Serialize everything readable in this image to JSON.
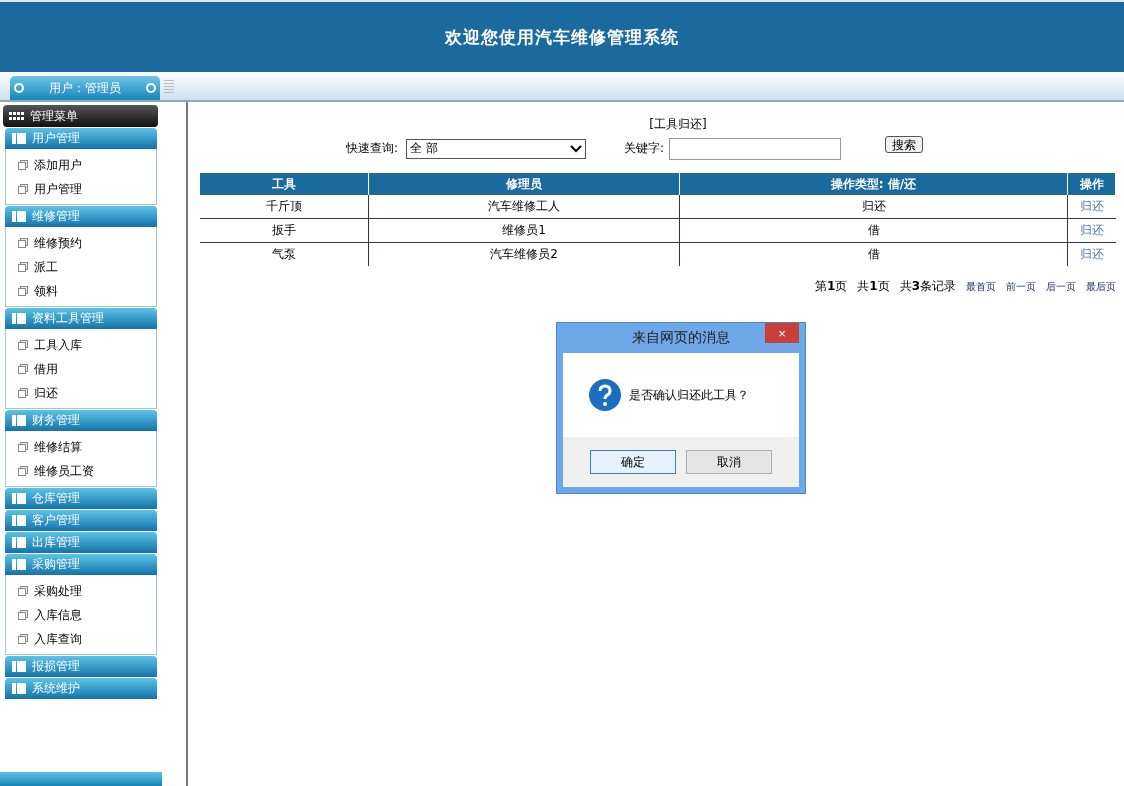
{
  "header": {
    "title": "欢迎您使用汽车维修管理系统"
  },
  "user_tab": {
    "label": "用户：管理员"
  },
  "sidebar": {
    "title": "管理菜单",
    "groups": [
      {
        "label": "用户管理",
        "items": [
          "添加用户",
          "用户管理"
        ]
      },
      {
        "label": "维修管理",
        "items": [
          "维修预约",
          "派工",
          "领料"
        ]
      },
      {
        "label": "资料工具管理",
        "items": [
          "工具入库",
          "借用",
          "归还"
        ]
      },
      {
        "label": "财务管理",
        "items": [
          "维修结算",
          "维修员工资"
        ]
      },
      {
        "label": "仓库管理"
      },
      {
        "label": "客户管理"
      },
      {
        "label": "出库管理"
      },
      {
        "label": "采购管理",
        "items": [
          "采购处理",
          "入库信息",
          "入库查询"
        ]
      },
      {
        "label": "报损管理"
      },
      {
        "label": "系统维护"
      }
    ]
  },
  "page_title": "[工具归还]",
  "search": {
    "quick_label": "快速查询:",
    "quick_value": "全 部",
    "keyword_label": "关键字:",
    "button": "搜索"
  },
  "table": {
    "columns": [
      "工具",
      "修理员",
      "操作类型: 借/还",
      "操作"
    ],
    "rows": [
      {
        "cells": [
          "千斤顶",
          "汽车维修工人",
          "归还"
        ],
        "action": "归还"
      },
      {
        "cells": [
          "扳手",
          "维修员1",
          "借"
        ],
        "action": "归还"
      },
      {
        "cells": [
          "气泵",
          "汽车维修员2",
          "借"
        ],
        "action": "归还"
      }
    ]
  },
  "pagination": {
    "info": [
      "第**1**页",
      "共**1**页",
      "共**3**条记录"
    ],
    "links": [
      "最首页",
      "前一页",
      "后一页",
      "最后页"
    ]
  },
  "dialog": {
    "title": "来自网页的消息",
    "close": "×",
    "message": "是否确认归还此工具？",
    "buttons": [
      {
        "label": "确定",
        "selected": true
      },
      {
        "label": "取消",
        "selected": false
      }
    ]
  }
}
